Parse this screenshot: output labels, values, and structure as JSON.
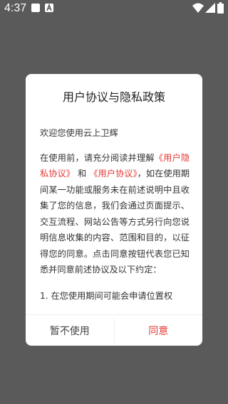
{
  "status_bar": {
    "time": "4:37",
    "icons": [
      "notification-square-icon",
      "notification-a-icon",
      "wifi-icon",
      "signal-icon",
      "battery-icon"
    ]
  },
  "dialog": {
    "title": "用户协议与隐私政策",
    "greeting": "欢迎您使用云上卫辉",
    "para_1": "在使用前，请充分阅读并理解",
    "link_privacy": "《用户隐私协议》",
    "and": "和",
    "link_user": "《用户协议》",
    "para_2": "，如在使用期间某一功能或服务未在前述说明中且收集了您的信息，我们会通过页面提示、交互流程、网站公告等方式另行向您说明信息收集的内容、范围和目的，以征得您的同意。点击同意按钮代表您已知悉并同意前述协议及以下约定：",
    "item_1": "1. 在您使用期间可能会申请位置权",
    "decline_label": "暂不使用",
    "agree_label": "同意"
  },
  "colors": {
    "overlay": "#5a5a5a",
    "accent": "#e53935"
  }
}
